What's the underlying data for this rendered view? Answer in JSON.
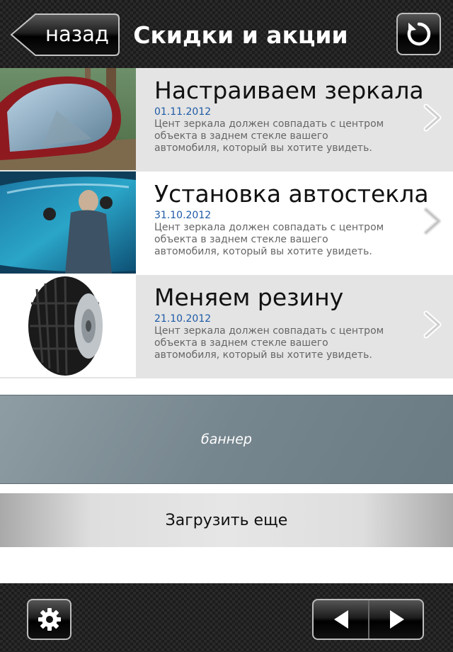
{
  "header": {
    "back_label": "назад",
    "title": "Скидки и акции",
    "refresh_icon": "refresh-icon"
  },
  "items": [
    {
      "title": "Настраиваем зеркала",
      "date": "01.11.2012",
      "description": "Цент зеркала должен совпадать с центром объекта в заднем стекле вашего автомобиля, который вы хотите увидеть.",
      "image": "car-mirror-photo"
    },
    {
      "title": "Установка автостекла",
      "date": "31.10.2012",
      "description": "Цент зеркала должен совпадать с центром объекта в заднем стекле вашего автомобиля, который вы хотите увидеть.",
      "image": "windshield-installation-photo"
    },
    {
      "title": "Меняем резину",
      "date": "21.10.2012",
      "description": "Цент зеркала должен совпадать с центром объекта в заднем стекле вашего автомобиля, который вы хотите увидеть.",
      "image": "tire-photo"
    }
  ],
  "banner": {
    "text": "баннер"
  },
  "load_more": {
    "label": "Загрузить еще"
  },
  "footer": {
    "settings_icon": "gear-icon",
    "prev_icon": "arrow-left-icon",
    "next_icon": "arrow-right-icon"
  },
  "colors": {
    "date": "#1d5aa6",
    "row_alt": "#e4e4e4",
    "banner": "#76868e"
  }
}
